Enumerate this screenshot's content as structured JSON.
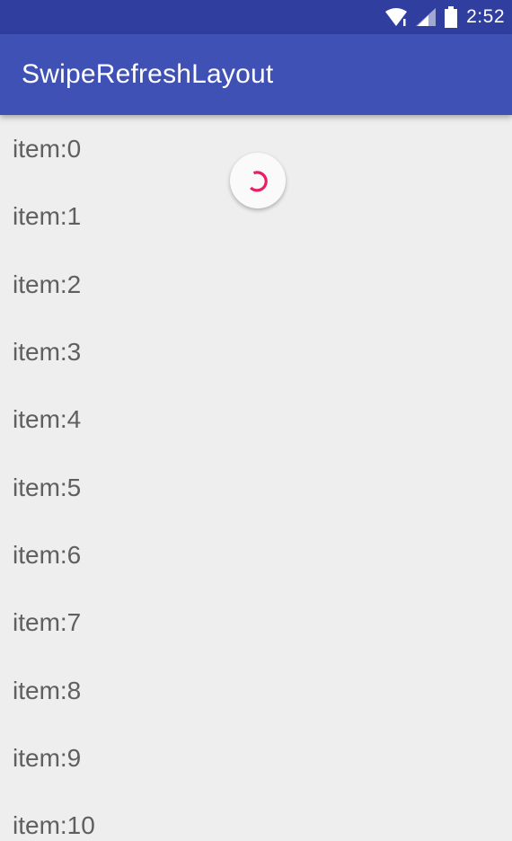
{
  "status_bar": {
    "time": "2:52",
    "icons": [
      "wifi-icon",
      "cell-signal-icon",
      "battery-icon"
    ],
    "background": "#303f9f"
  },
  "app_bar": {
    "title": "SwipeRefreshLayout",
    "background": "#3f51b5"
  },
  "refresh_indicator": {
    "icon": "refresh-spinner-icon",
    "accent": "#e91e63"
  },
  "list": {
    "items": [
      {
        "label": "item:0"
      },
      {
        "label": "item:1"
      },
      {
        "label": "item:2"
      },
      {
        "label": "item:3"
      },
      {
        "label": "item:4"
      },
      {
        "label": "item:5"
      },
      {
        "label": "item:6"
      },
      {
        "label": "item:7"
      },
      {
        "label": "item:8"
      },
      {
        "label": "item:9"
      },
      {
        "label": "item:10"
      }
    ]
  }
}
